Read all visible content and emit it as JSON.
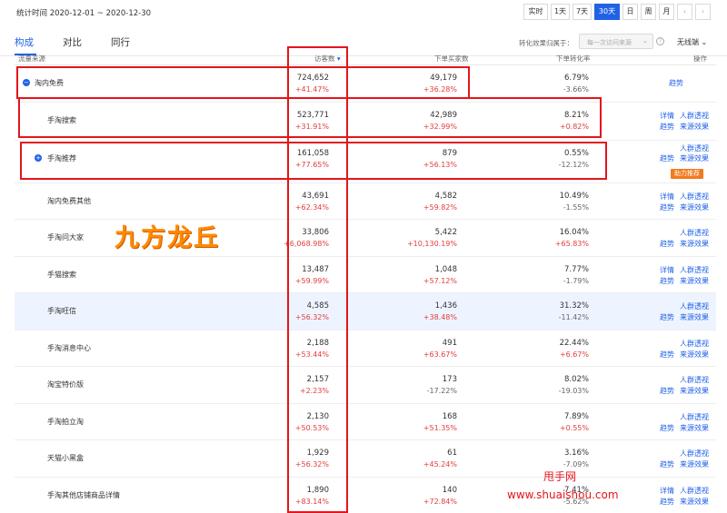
{
  "header": {
    "period_text": "统计时间 2020-12-01 ~ 2020-12-30",
    "ranges": [
      "实时",
      "1天",
      "7天",
      "30天",
      "日",
      "周",
      "月"
    ],
    "active_range": "30天",
    "prev_icon": "chevron-left-icon",
    "next_icon": "chevron-right-icon"
  },
  "tabs": [
    "构成",
    "对比",
    "同行"
  ],
  "active_tab": "构成",
  "attribution": {
    "label": "转化效果归属于：",
    "placeholder": "每一次访问来源",
    "compare": "无线端"
  },
  "columns": {
    "source": "流量来源",
    "visitors": "访客数",
    "buyers": "下单买家数",
    "rate": "下单转化率",
    "ops": "操作"
  },
  "rows": [
    {
      "name": "淘内免费",
      "expand": "−",
      "visitors": "724,652",
      "visitors_delta": "+41.47%",
      "buyers": "49,179",
      "buyers_delta": "+36.28%",
      "rate": "6.79%",
      "rate_delta": "-3.66%",
      "actions": [
        "趋势"
      ]
    },
    {
      "name": "手淘搜索",
      "visitors": "523,771",
      "visitors_delta": "+31.91%",
      "buyers": "42,989",
      "buyers_delta": "+32.99%",
      "rate": "8.21%",
      "rate_delta": "+0.82%",
      "actions": [
        "详情",
        "人群透视",
        "趋势",
        "来源效果"
      ]
    },
    {
      "name": "手淘推荐",
      "expand": "+",
      "visitors": "161,058",
      "visitors_delta": "+77.65%",
      "buyers": "879",
      "buyers_delta": "+56.13%",
      "rate": "0.55%",
      "rate_delta": "-12.12%",
      "actions": [
        "人群透视",
        "趋势",
        "来源效果"
      ],
      "badge": "助力推荐"
    },
    {
      "name": "淘内免费其他",
      "visitors": "43,691",
      "visitors_delta": "+62.34%",
      "buyers": "4,582",
      "buyers_delta": "+59.82%",
      "rate": "10.49%",
      "rate_delta": "-1.55%",
      "actions": [
        "详情",
        "人群透视",
        "趋势",
        "来源效果"
      ]
    },
    {
      "name": "手淘问大家",
      "visitors": "33,806",
      "visitors_delta": "+6,068.98%",
      "buyers": "5,422",
      "buyers_delta": "+10,130.19%",
      "rate": "16.04%",
      "rate_delta": "+65.83%",
      "actions": [
        "人群透视",
        "趋势",
        "来源效果"
      ]
    },
    {
      "name": "手猫搜索",
      "visitors": "13,487",
      "visitors_delta": "+59.99%",
      "buyers": "1,048",
      "buyers_delta": "+57.12%",
      "rate": "7.77%",
      "rate_delta": "-1.79%",
      "actions": [
        "详情",
        "人群透视",
        "趋势",
        "来源效果"
      ]
    },
    {
      "name": "手淘旺信",
      "visitors": "4,585",
      "visitors_delta": "+56.32%",
      "buyers": "1,436",
      "buyers_delta": "+38.48%",
      "rate": "31.32%",
      "rate_delta": "-11.42%",
      "actions": [
        "人群透视",
        "趋势",
        "来源效果"
      ]
    },
    {
      "name": "手淘消息中心",
      "visitors": "2,188",
      "visitors_delta": "+53.44%",
      "buyers": "491",
      "buyers_delta": "+63.67%",
      "rate": "22.44%",
      "rate_delta": "+6.67%",
      "actions": [
        "人群透视",
        "趋势",
        "来源效果"
      ]
    },
    {
      "name": "淘宝特价版",
      "visitors": "2,157",
      "visitors_delta": "+2.23%",
      "buyers": "173",
      "buyers_delta": "-17.22%",
      "rate": "8.02%",
      "rate_delta": "-19.03%",
      "actions": [
        "人群透视",
        "趋势",
        "来源效果"
      ]
    },
    {
      "name": "手淘拍立淘",
      "visitors": "2,130",
      "visitors_delta": "+50.53%",
      "buyers": "168",
      "buyers_delta": "+51.35%",
      "rate": "7.89%",
      "rate_delta": "+0.55%",
      "actions": [
        "人群透视",
        "趋势",
        "来源效果"
      ]
    },
    {
      "name": "天猫小黑盒",
      "visitors": "1,929",
      "visitors_delta": "+56.32%",
      "buyers": "61",
      "buyers_delta": "+45.24%",
      "rate": "3.16%",
      "rate_delta": "-7.09%",
      "actions": [
        "人群透视",
        "趋势",
        "来源效果"
      ]
    },
    {
      "name": "手淘其他店铺商品详情",
      "visitors": "1,890",
      "visitors_delta": "+83.14%",
      "buyers": "140",
      "buyers_delta": "+72.84%",
      "rate": "7.41%",
      "rate_delta": "-5.62%",
      "actions": [
        "详情",
        "人群透视",
        "趋势",
        "来源效果"
      ]
    }
  ],
  "watermarks": {
    "big": "九方龙丘",
    "site_name": "甩手网",
    "site_url": "www.shuaishou.com"
  },
  "colors": {
    "accent": "#2062e6",
    "up": "#e33c3c",
    "annotation": "#e3151b",
    "badge": "#f27b1e"
  }
}
